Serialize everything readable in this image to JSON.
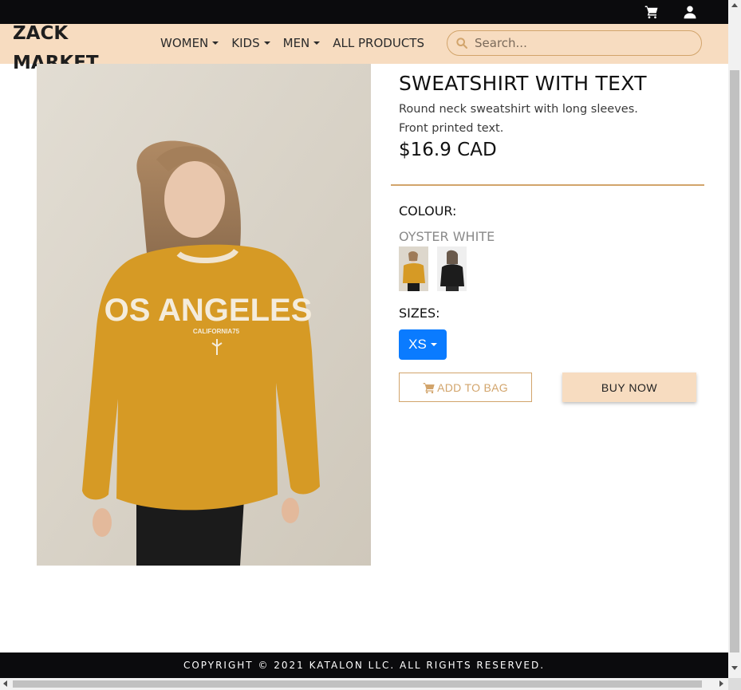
{
  "topbar": {
    "cart_icon": "cart-icon",
    "user_icon": "user-icon"
  },
  "navbar": {
    "brand": "ZACK MARKET",
    "items": [
      {
        "label": "WOMEN",
        "dropdown": true
      },
      {
        "label": "KIDS",
        "dropdown": true
      },
      {
        "label": "MEN",
        "dropdown": true
      },
      {
        "label": "ALL PRODUCTS",
        "dropdown": false
      }
    ],
    "search_placeholder": "Search..."
  },
  "product": {
    "title": "SWEATSHIRT WITH TEXT",
    "description": "Round neck sweatshirt with long sleeves. Front printed text.",
    "price": "$16.9 CAD",
    "colour_label": "COLOUR:",
    "colour_value": "OYSTER WHITE",
    "sizes_label": "SIZES:",
    "selected_size": "XS",
    "add_to_bag": "ADD TO BAG",
    "buy_now": "BUY NOW",
    "image_print": "OS ANGELES",
    "image_subprint": "CALIFORNIA75"
  },
  "footer": {
    "text": "COPYRIGHT © 2021 KATALON LLC. ALL RIGHTS RESERVED."
  },
  "colors": {
    "accent": "#d2a46b",
    "nav_bg": "#f7dcc0",
    "primary_blue": "#0a7bff",
    "dark": "#0b0b0d"
  }
}
